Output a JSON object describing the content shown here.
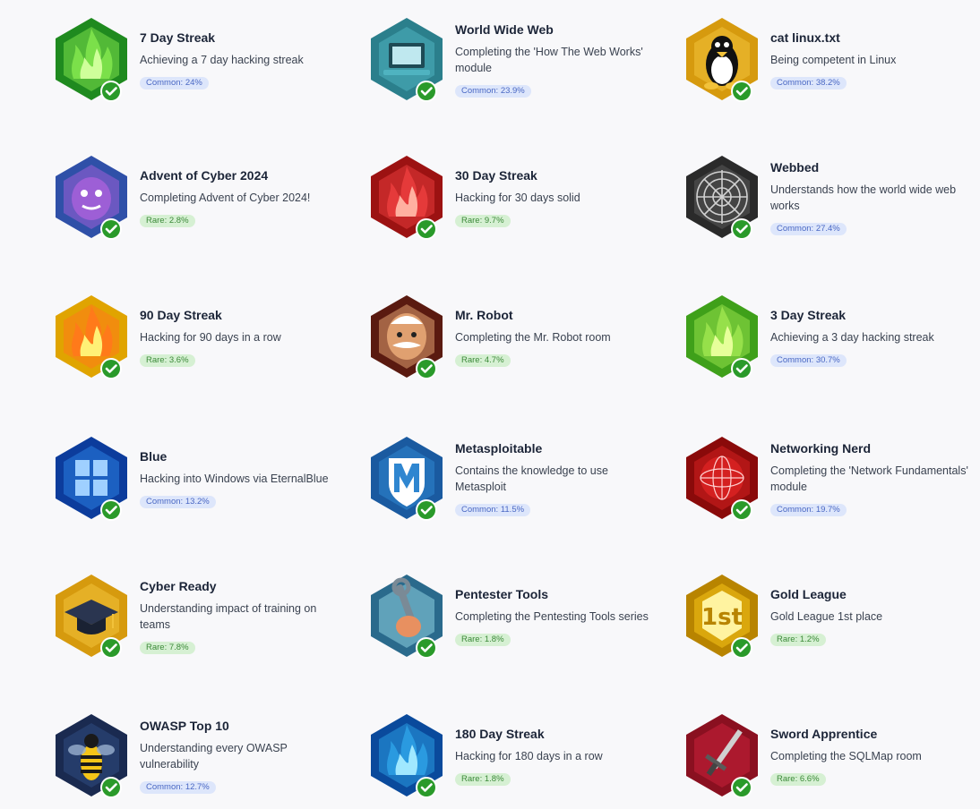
{
  "badges": [
    {
      "title": "7 Day Streak",
      "desc": "Achieving a 7 day hacking streak",
      "rarity": "Common: 24%",
      "tier": "common",
      "icon": "green-flame-icon",
      "c1": "#1f8a1f",
      "c2": "#7be04a",
      "c3": "#cfff9a"
    },
    {
      "title": "World Wide Web",
      "desc": "Completing the 'How The Web Works' module",
      "rarity": "Common: 23.9%",
      "tier": "common",
      "icon": "laptop-icon",
      "c1": "#2b7f8c",
      "c2": "#4fb3c0",
      "c3": "#bfe8ef"
    },
    {
      "title": "cat linux.txt",
      "desc": "Being competent in Linux",
      "rarity": "Common: 38.2%",
      "tier": "common",
      "icon": "tux-penguin-icon",
      "c1": "#d69a0e",
      "c2": "#f2c23a",
      "c3": "#ffffff"
    },
    {
      "title": "Advent of Cyber 2024",
      "desc": "Completing Advent of Cyber 2024!",
      "rarity": "Rare: 2.8%",
      "tier": "rare",
      "icon": "purple-monster-icon",
      "c1": "#2f50a8",
      "c2": "#9d5fd6",
      "c3": "#e7d4ff"
    },
    {
      "title": "30 Day Streak",
      "desc": "Hacking for 30 days solid",
      "rarity": "Rare: 9.7%",
      "tier": "rare",
      "icon": "red-flame-icon",
      "c1": "#9c1212",
      "c2": "#e53a3a",
      "c3": "#ffb0a0"
    },
    {
      "title": "Webbed",
      "desc": "Understands how the world wide web works",
      "rarity": "Common: 27.4%",
      "tier": "common",
      "icon": "spider-web-icon",
      "c1": "#2a2a2a",
      "c2": "#5a5a5a",
      "c3": "#d0d0d0"
    },
    {
      "title": "90 Day Streak",
      "desc": "Hacking for 90 days in a row",
      "rarity": "Rare: 3.6%",
      "tier": "rare",
      "icon": "yellow-flame-icon",
      "c1": "#e0a400",
      "c2": "#ff7a1a",
      "c3": "#fff176"
    },
    {
      "title": "Mr. Robot",
      "desc": "Completing the Mr. Robot room",
      "rarity": "Rare: 4.7%",
      "tier": "rare",
      "icon": "mr-robot-mask-icon",
      "c1": "#5a1a10",
      "c2": "#e0a070",
      "c3": "#ffffff"
    },
    {
      "title": "3 Day Streak",
      "desc": "Achieving a 3 day hacking streak",
      "rarity": "Common: 30.7%",
      "tier": "common",
      "icon": "lime-flame-icon",
      "c1": "#3fa01a",
      "c2": "#96e04a",
      "c3": "#e6ff9a"
    },
    {
      "title": "Blue",
      "desc": "Hacking into Windows via EternalBlue",
      "rarity": "Common: 13.2%",
      "tier": "common",
      "icon": "windows-logo-icon",
      "c1": "#0c3c9c",
      "c2": "#2a7de0",
      "c3": "#9fd0ff"
    },
    {
      "title": "Metasploitable",
      "desc": "Contains the knowledge to use Metasploit",
      "rarity": "Common: 11.5%",
      "tier": "common",
      "icon": "metasploit-shield-icon",
      "c1": "#1a5aa0",
      "c2": "#2f86d0",
      "c3": "#ffffff"
    },
    {
      "title": "Networking Nerd",
      "desc": "Completing the 'Network Fundamentals' module",
      "rarity": "Common: 19.7%",
      "tier": "common",
      "icon": "network-globe-icon",
      "c1": "#8a0a0a",
      "c2": "#d42020",
      "c3": "#ffd0d0"
    },
    {
      "title": "Cyber Ready",
      "desc": "Understanding impact of training on teams",
      "rarity": "Rare: 7.8%",
      "tier": "rare",
      "icon": "graduation-cap-icon",
      "c1": "#d69a0e",
      "c2": "#f2c23a",
      "c3": "#2a3550"
    },
    {
      "title": "Pentester Tools",
      "desc": "Completing the Pentesting Tools series",
      "rarity": "Rare: 1.8%",
      "tier": "rare",
      "icon": "wrench-hand-icon",
      "c1": "#2a6a8c",
      "c2": "#8ccfe0",
      "c3": "#e89060"
    },
    {
      "title": "Gold League",
      "desc": "Gold League 1st place",
      "rarity": "Rare: 1.2%",
      "tier": "rare",
      "icon": "gold-medal-1st-icon",
      "c1": "#b88400",
      "c2": "#f5c518",
      "c3": "#fff3a0"
    },
    {
      "title": "OWASP Top 10",
      "desc": "Understanding every OWASP vulnerability",
      "rarity": "Common: 12.7%",
      "tier": "common",
      "icon": "wasp-icon",
      "c1": "#1a2a50",
      "c2": "#2f4a80",
      "c3": "#f5c518"
    },
    {
      "title": "180 Day Streak",
      "desc": "Hacking for 180 days in a row",
      "rarity": "Rare: 1.8%",
      "tier": "rare",
      "icon": "blue-flame-icon",
      "c1": "#0a4a9c",
      "c2": "#2a9ae0",
      "c3": "#a0e8ff"
    },
    {
      "title": "Sword Apprentice",
      "desc": "Completing the SQLMap room",
      "rarity": "Rare: 6.6%",
      "tier": "rare",
      "icon": "sword-icon",
      "c1": "#8a1020",
      "c2": "#c8203a",
      "c3": "#d0d0d0"
    }
  ]
}
